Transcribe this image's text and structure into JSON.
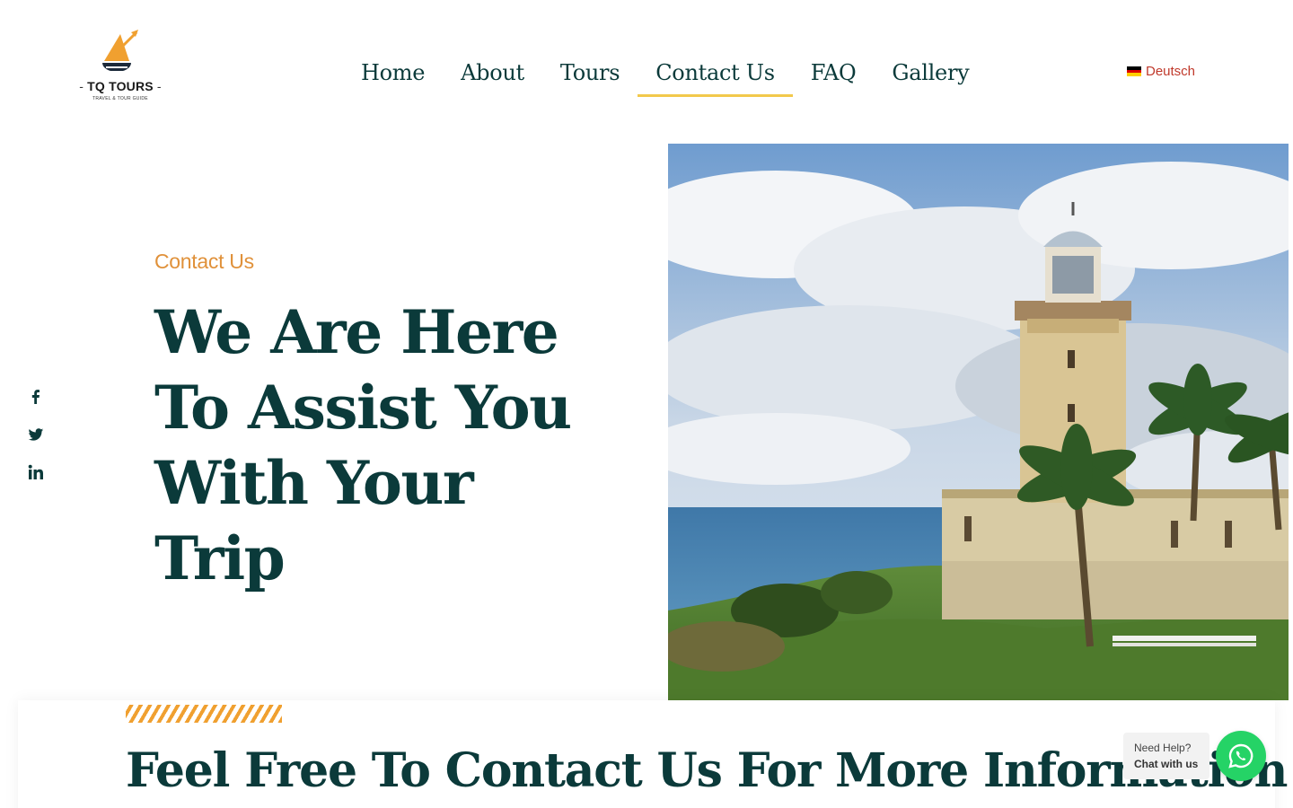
{
  "brand": {
    "name": "TQ TOURS",
    "tagline": "TRAVEL & TOUR GUIDE",
    "logo_icon": "sailboat-sun-arrow-icon",
    "accent_color": "#f0a030"
  },
  "nav": {
    "items": [
      {
        "label": "Home",
        "active": false
      },
      {
        "label": "About",
        "active": false
      },
      {
        "label": "Tours",
        "active": false
      },
      {
        "label": "Contact Us",
        "active": true
      },
      {
        "label": "FAQ",
        "active": false
      },
      {
        "label": "Gallery",
        "active": false
      }
    ],
    "active_underline_color": "#f2c94c"
  },
  "language": {
    "label": "Deutsch",
    "icon": "german-flag-icon"
  },
  "social": [
    {
      "icon": "facebook-icon"
    },
    {
      "icon": "twitter-icon"
    },
    {
      "icon": "linkedin-icon"
    }
  ],
  "hero": {
    "eyebrow": "Contact Us",
    "title": "We Are Here To Assist You With Your Trip",
    "image": "lighthouse-coast-photo",
    "title_color": "#0b3a3a",
    "eyebrow_color": "#e0913a"
  },
  "section": {
    "title": "Feel Free To Contact Us For More Information"
  },
  "chat": {
    "help": "Need Help?",
    "link": "Chat with us",
    "icon": "whatsapp-icon",
    "color": "#25d366"
  }
}
